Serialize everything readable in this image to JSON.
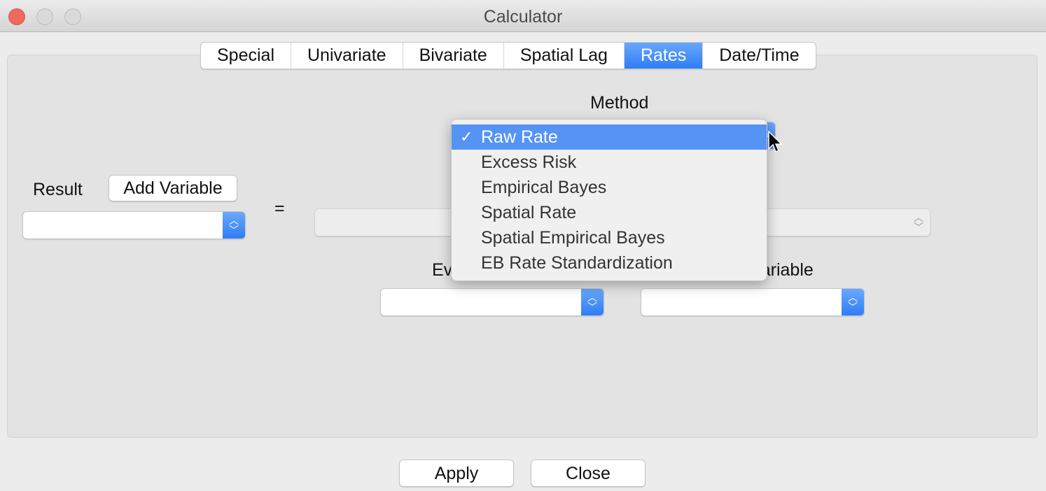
{
  "window": {
    "title": "Calculator",
    "controls": [
      "close",
      "minimize",
      "zoom"
    ]
  },
  "tabs": [
    {
      "label": "Special"
    },
    {
      "label": "Univariate"
    },
    {
      "label": "Bivariate"
    },
    {
      "label": "Spatial Lag"
    },
    {
      "label": "Rates",
      "active": true
    },
    {
      "label": "Date/Time"
    }
  ],
  "form": {
    "method_label": "Method",
    "result_label": "Result",
    "add_variable_label": "Add Variable",
    "equals": "=",
    "event_label": "Event Variable",
    "base_label": "Base Variable",
    "result_value": "",
    "event_value": "",
    "base_value": ""
  },
  "method_menu": {
    "selected": "Raw Rate",
    "items": [
      "Raw Rate",
      "Excess Risk",
      "Empirical Bayes",
      "Spatial Rate",
      "Spatial Empirical Bayes",
      "EB Rate Standardization"
    ],
    "check_icon": "✓"
  },
  "footer": {
    "apply_label": "Apply",
    "close_label": "Close"
  },
  "colors": {
    "accent": "#2f7ef5",
    "menu_highlight": "#5593f5",
    "close_light": "#ee6a5f"
  }
}
